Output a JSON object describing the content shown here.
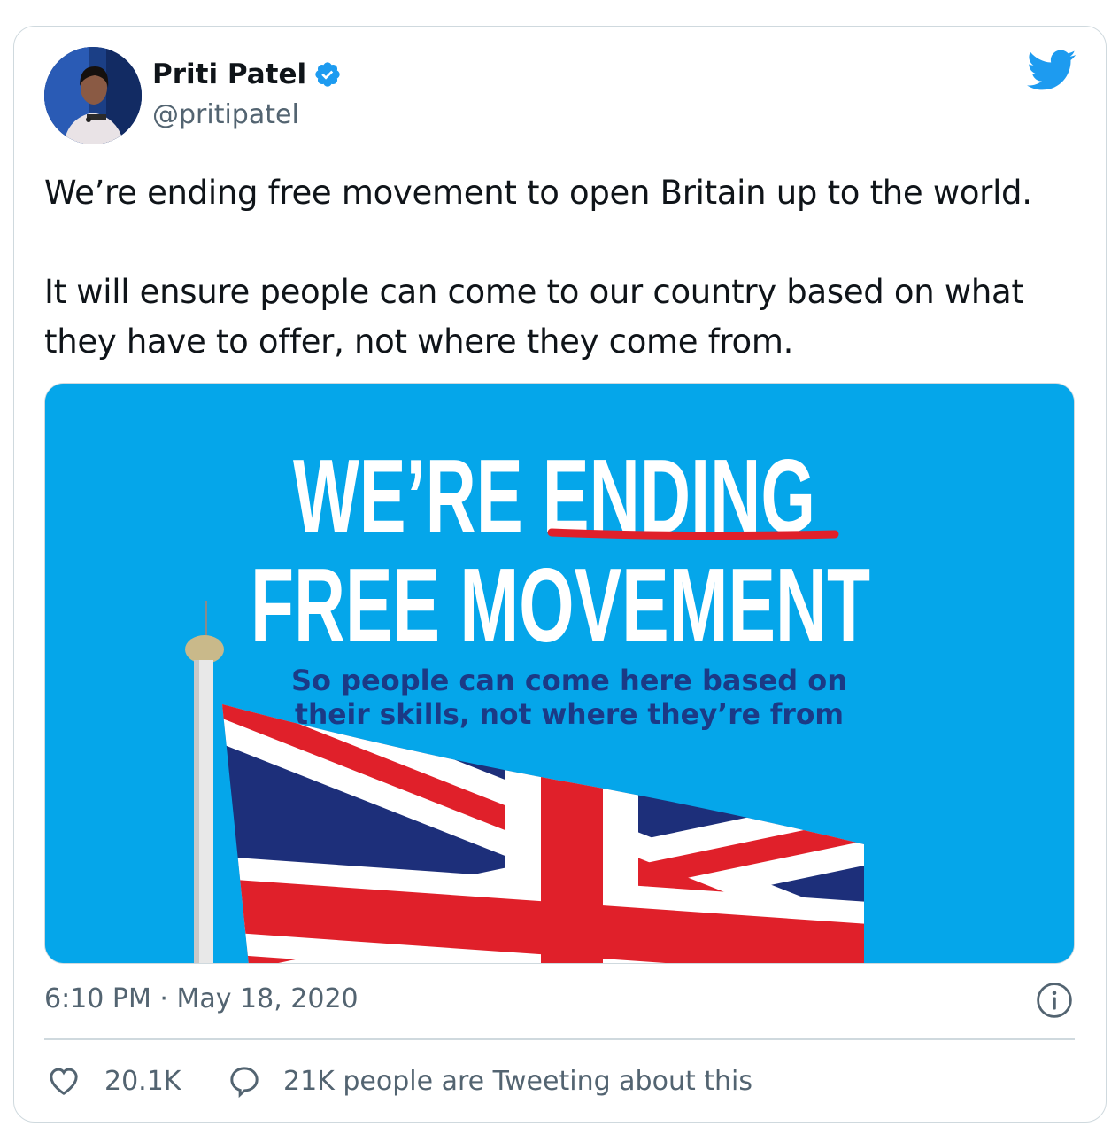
{
  "tweet": {
    "author": {
      "name": "Priti Patel",
      "handle": "@pritipatel"
    },
    "text": [
      "We’re ending free movement to open Britain up to the world.",
      "It will ensure people can come to our country based on what they have to offer, not where they come from."
    ],
    "media": {
      "headline_line1_a": "WE’RE ",
      "headline_line1_b": "ENDING",
      "headline_line2": "FREE MOVEMENT",
      "subline1": "So people can come here based on",
      "subline2": "their skills, not where they’re from"
    },
    "timestamp": "6:10 PM · May 18, 2020",
    "actions": {
      "likes": "20.1K",
      "conversation": "21K people are Tweeting about this"
    }
  },
  "colors": {
    "accent": "#1d9bf0",
    "media_background": "#05a6ea",
    "headline_sub": "#1b3a86",
    "underline_red": "#e0202a"
  }
}
